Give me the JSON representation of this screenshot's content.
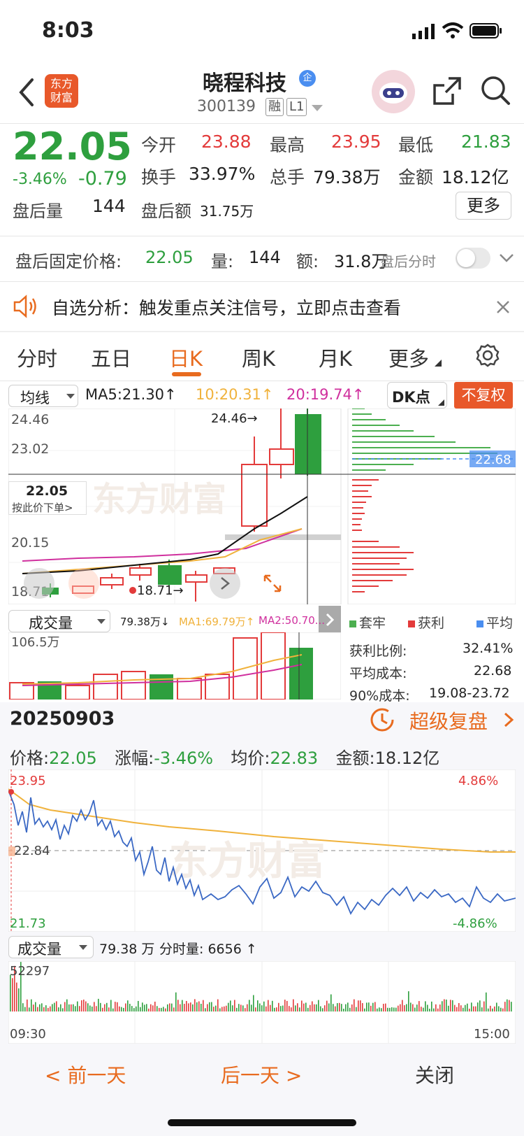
{
  "status_bar": {
    "time": "8:03"
  },
  "header": {
    "logo_text_1": "东方",
    "logo_text_2": "财富",
    "stock_name": "晓程科技",
    "badge": "企",
    "stock_code": "300139",
    "tag_margin": "融",
    "tag_level": "L1"
  },
  "quote": {
    "price": "22.05",
    "change_pct": "-3.46%",
    "change": "-0.79",
    "open_label": "今开",
    "open": "23.88",
    "high_label": "最高",
    "high": "23.95",
    "low_label": "最低",
    "low": "21.83",
    "turnover_label": "换手",
    "turnover": "33.97%",
    "volume_label": "总手",
    "volume": "79.38万",
    "amount_label": "金额",
    "amount": "18.12亿",
    "after_vol_label": "盘后量",
    "after_vol": "144",
    "after_amt_label": "盘后额",
    "after_amt": "31.75万",
    "more_button": "更多"
  },
  "after_hours": {
    "price_label": "盘后固定价格:",
    "price": "22.05",
    "vol_label": "量:",
    "vol": "144",
    "amt_label": "额:",
    "amt": "31.8万",
    "toggle_label": "盘后分时"
  },
  "notice": {
    "text": "自选分析：触发重点关注信号，立即点击查看"
  },
  "tabs": [
    "分时",
    "五日",
    "日K",
    "周K",
    "月K",
    "更多"
  ],
  "active_tab": "日K",
  "kline": {
    "ma_select": "均线",
    "ma5": "MA5:21.30↑",
    "ma10": "10:20.31↑",
    "ma20": "20:19.74↑",
    "dk_button": "DK点",
    "adjust_button": "不复权",
    "y_labels": [
      "24.46",
      "23.02",
      "20.15",
      "18.71"
    ],
    "high_marker": "24.46→",
    "low_marker": "18.71→",
    "cursor_price": "22.05",
    "cursor_hint": "按此价下单>",
    "cost_price": "22.68",
    "vol_select": "成交量",
    "vol_value": "79.38万↓",
    "vol_ma1": "MA1:69.79万↑",
    "vol_ma2": "MA2:50.70...",
    "vol_max": "106.5万",
    "legend": [
      "套牢",
      "获利",
      "平均"
    ],
    "profit_ratio_label": "获利比例:",
    "profit_ratio": "32.41%",
    "avg_cost_label": "平均成本:",
    "avg_cost": "22.68",
    "cost90_label": "90%成本:",
    "cost90": "19.08-23.72"
  },
  "replay": {
    "date": "20250903",
    "button": "超级复盘",
    "price_label": "价格:",
    "price": "22.05",
    "change_label": "涨幅:",
    "change": "-3.46%",
    "avg_label": "均价:",
    "avg": "22.83",
    "amount_label": "金额:",
    "amount": "18.12亿"
  },
  "intraday": {
    "high": "23.95",
    "mid": "22.84",
    "low": "21.73",
    "up_pct": "4.86%",
    "down_pct": "-4.86%",
    "vol_select": "成交量",
    "vol_total": "79.38 万",
    "vol_minute": "分时量: 6656 ↑",
    "vol_max": "52297",
    "time_start": "09:30",
    "time_end": "15:00"
  },
  "footer": {
    "prev": "前一天",
    "next": "后一天",
    "close": "关闭"
  },
  "colors": {
    "up": "#e33b3b",
    "down": "#2e9f3e",
    "accent": "#e86b1f"
  }
}
